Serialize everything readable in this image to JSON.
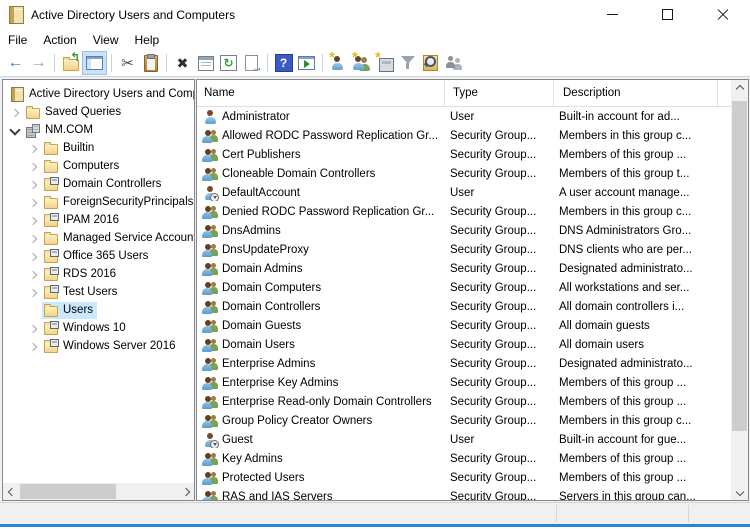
{
  "window": {
    "title": "Active Directory Users and Computers",
    "controls": [
      {
        "name": "minimize-button",
        "icon": "minimize-icon"
      },
      {
        "name": "maximize-button",
        "icon": "maximize-icon"
      },
      {
        "name": "close-button",
        "icon": "close-icon"
      }
    ]
  },
  "menubar": {
    "items": [
      {
        "name": "menu-file",
        "label": "File"
      },
      {
        "name": "menu-action",
        "label": "Action"
      },
      {
        "name": "menu-view",
        "label": "View"
      },
      {
        "name": "menu-help",
        "label": "Help"
      }
    ]
  },
  "toolbar": {
    "items": [
      {
        "name": "back-button",
        "type": "back",
        "glyph": "←",
        "interactable": "true"
      },
      {
        "name": "forward-button",
        "type": "forward",
        "glyph": "→",
        "interactable": "true"
      },
      {
        "name": "toolbar-separator",
        "type": "sep",
        "interactable": "false"
      },
      {
        "name": "up-one-level-button",
        "type": "upfolder",
        "glyph": "↰",
        "interactable": "true"
      },
      {
        "name": "show-console-tree-toggle",
        "type": "treetoggle",
        "state": "selected",
        "interactable": "true"
      },
      {
        "name": "toolbar-separator",
        "type": "sep",
        "interactable": "false"
      },
      {
        "name": "cut-button",
        "type": "cut",
        "glyph": "✂",
        "interactable": "true"
      },
      {
        "name": "paste-button",
        "type": "paste",
        "interactable": "true"
      },
      {
        "name": "toolbar-separator",
        "type": "sep",
        "interactable": "false"
      },
      {
        "name": "delete-button",
        "type": "delete",
        "glyph": "✖",
        "interactable": "true"
      },
      {
        "name": "properties-button",
        "type": "properties",
        "interactable": "true"
      },
      {
        "name": "refresh-button",
        "type": "refresh",
        "glyph": "↻",
        "interactable": "true"
      },
      {
        "name": "export-list-button",
        "type": "export",
        "glyph": "→",
        "interactable": "true"
      },
      {
        "name": "toolbar-separator",
        "type": "sep",
        "interactable": "false"
      },
      {
        "name": "help-button",
        "type": "help",
        "glyph": "?",
        "interactable": "true"
      },
      {
        "name": "show-in-new-window-button",
        "type": "newwindow",
        "interactable": "true"
      },
      {
        "name": "toolbar-separator",
        "type": "sep",
        "interactable": "false"
      },
      {
        "name": "new-user-button",
        "type": "newuser",
        "glyph": "*",
        "interactable": "true"
      },
      {
        "name": "new-group-button",
        "type": "newgroup",
        "glyph": "*",
        "interactable": "true"
      },
      {
        "name": "new-ou-button",
        "type": "newou",
        "glyph": "*",
        "interactable": "true"
      },
      {
        "name": "filter-button",
        "type": "filter",
        "interactable": "true"
      },
      {
        "name": "find-button",
        "type": "find",
        "interactable": "true"
      },
      {
        "name": "add-to-group-button",
        "type": "members",
        "interactable": "true"
      }
    ]
  },
  "tree": {
    "items": [
      {
        "name": "tree-item-root",
        "label": "Active Directory Users and Computers",
        "depth_class": "d0",
        "icon": "root",
        "icon_name": "directory-icon",
        "expander": "none"
      },
      {
        "name": "tree-item-saved-queries",
        "label": "Saved Queries",
        "depth_class": "d1",
        "icon": "folder",
        "icon_name": "folder-icon",
        "expander": "collapsed"
      },
      {
        "name": "tree-item-nm-com",
        "label": "NM.COM",
        "depth_class": "d1",
        "icon": "domain",
        "icon_name": "domain-icon",
        "expander": "expanded"
      },
      {
        "name": "tree-item-builtin",
        "label": "Builtin",
        "depth_class": "d2",
        "icon": "folder",
        "icon_name": "folder-icon",
        "expander": "collapsed"
      },
      {
        "name": "tree-item-computers",
        "label": "Computers",
        "depth_class": "d2",
        "icon": "folder",
        "icon_name": "folder-icon",
        "expander": "collapsed"
      },
      {
        "name": "tree-item-domain-controllers",
        "label": "Domain Controllers",
        "depth_class": "d2",
        "icon": "ou",
        "icon_name": "ou-folder-icon",
        "expander": "collapsed"
      },
      {
        "name": "tree-item-foreignsecurityprincipals",
        "label": "ForeignSecurityPrincipals",
        "depth_class": "d2",
        "icon": "folder",
        "icon_name": "folder-icon",
        "expander": "collapsed"
      },
      {
        "name": "tree-item-ipam-2016",
        "label": "IPAM 2016",
        "depth_class": "d2",
        "icon": "ou",
        "icon_name": "ou-folder-icon",
        "expander": "collapsed"
      },
      {
        "name": "tree-item-managed-service-accounts",
        "label": "Managed Service Accounts",
        "depth_class": "d2",
        "icon": "folder",
        "icon_name": "folder-icon",
        "expander": "collapsed"
      },
      {
        "name": "tree-item-office-365-users",
        "label": "Office 365 Users",
        "depth_class": "d2",
        "icon": "ou",
        "icon_name": "ou-folder-icon",
        "expander": "collapsed"
      },
      {
        "name": "tree-item-rds-2016",
        "label": "RDS 2016",
        "depth_class": "d2",
        "icon": "ou",
        "icon_name": "ou-folder-icon",
        "expander": "collapsed"
      },
      {
        "name": "tree-item-test-users",
        "label": "Test Users",
        "depth_class": "d2",
        "icon": "ou",
        "icon_name": "ou-folder-icon",
        "expander": "collapsed"
      },
      {
        "name": "tree-item-users",
        "label": "Users",
        "depth_class": "d2",
        "icon": "folder",
        "icon_name": "folder-icon",
        "expander": "none",
        "state": "selected"
      },
      {
        "name": "tree-item-windows-10",
        "label": "Windows 10",
        "depth_class": "d2",
        "icon": "ou",
        "icon_name": "ou-folder-icon",
        "expander": "collapsed"
      },
      {
        "name": "tree-item-windows-server-2016",
        "label": "Windows Server 2016",
        "depth_class": "d2",
        "icon": "ou",
        "icon_name": "ou-folder-icon",
        "expander": "collapsed"
      }
    ]
  },
  "list": {
    "columns": [
      {
        "id": "name",
        "name": "column-header-name",
        "label": "Name"
      },
      {
        "id": "type",
        "name": "column-header-type",
        "label": "Type"
      },
      {
        "id": "description",
        "name": "column-header-description",
        "label": "Description"
      }
    ],
    "rows": [
      {
        "name": "Administrator",
        "type": "User",
        "description": "Built-in account for ad...",
        "icon": "user",
        "icon_name": "user-icon"
      },
      {
        "name": "Allowed RODC Password Replication Gr...",
        "type": "Security Group...",
        "description": "Members in this group c...",
        "icon": "group",
        "icon_name": "group-icon"
      },
      {
        "name": "Cert Publishers",
        "type": "Security Group...",
        "description": "Members of this group ...",
        "icon": "group",
        "icon_name": "group-icon"
      },
      {
        "name": "Cloneable Domain Controllers",
        "type": "Security Group...",
        "description": "Members of this group t...",
        "icon": "group",
        "icon_name": "group-icon"
      },
      {
        "name": "DefaultAccount",
        "type": "User",
        "description": "A user account manage...",
        "icon": "userb",
        "icon_name": "disabled-user-icon"
      },
      {
        "name": "Denied RODC Password Replication Gr...",
        "type": "Security Group...",
        "description": "Members in this group c...",
        "icon": "group",
        "icon_name": "group-icon"
      },
      {
        "name": "DnsAdmins",
        "type": "Security Group...",
        "description": "DNS Administrators Gro...",
        "icon": "group",
        "icon_name": "group-icon"
      },
      {
        "name": "DnsUpdateProxy",
        "type": "Security Group...",
        "description": "DNS clients who are per...",
        "icon": "group",
        "icon_name": "group-icon"
      },
      {
        "name": "Domain Admins",
        "type": "Security Group...",
        "description": "Designated administrato...",
        "icon": "group",
        "icon_name": "group-icon"
      },
      {
        "name": "Domain Computers",
        "type": "Security Group...",
        "description": "All workstations and ser...",
        "icon": "group",
        "icon_name": "group-icon"
      },
      {
        "name": "Domain Controllers",
        "type": "Security Group...",
        "description": "All domain controllers i...",
        "icon": "group",
        "icon_name": "group-icon"
      },
      {
        "name": "Domain Guests",
        "type": "Security Group...",
        "description": "All domain guests",
        "icon": "group",
        "icon_name": "group-icon"
      },
      {
        "name": "Domain Users",
        "type": "Security Group...",
        "description": "All domain users",
        "icon": "group",
        "icon_name": "group-icon"
      },
      {
        "name": "Enterprise Admins",
        "type": "Security Group...",
        "description": "Designated administrato...",
        "icon": "group",
        "icon_name": "group-icon"
      },
      {
        "name": "Enterprise Key Admins",
        "type": "Security Group...",
        "description": "Members of this group ...",
        "icon": "group",
        "icon_name": "group-icon"
      },
      {
        "name": "Enterprise Read-only Domain Controllers",
        "type": "Security Group...",
        "description": "Members of this group ...",
        "icon": "group",
        "icon_name": "group-icon"
      },
      {
        "name": "Group Policy Creator Owners",
        "type": "Security Group...",
        "description": "Members in this group c...",
        "icon": "group",
        "icon_name": "group-icon"
      },
      {
        "name": "Guest",
        "type": "User",
        "description": "Built-in account for gue...",
        "icon": "userb",
        "icon_name": "disabled-user-icon"
      },
      {
        "name": "Key Admins",
        "type": "Security Group...",
        "description": "Members of this group ...",
        "icon": "group",
        "icon_name": "group-icon"
      },
      {
        "name": "Protected Users",
        "type": "Security Group...",
        "description": "Members of this group ...",
        "icon": "group",
        "icon_name": "group-icon"
      },
      {
        "name": "RAS and IAS Servers",
        "type": "Security Group...",
        "description": "Servers in this group can...",
        "icon": "group",
        "icon_name": "group-icon"
      }
    ]
  },
  "colors": {
    "accent_bottom_border": "#2e86d1",
    "tree_selection": "#cce8ff",
    "toolbar_toggle_selected": "#c9e2f7"
  }
}
